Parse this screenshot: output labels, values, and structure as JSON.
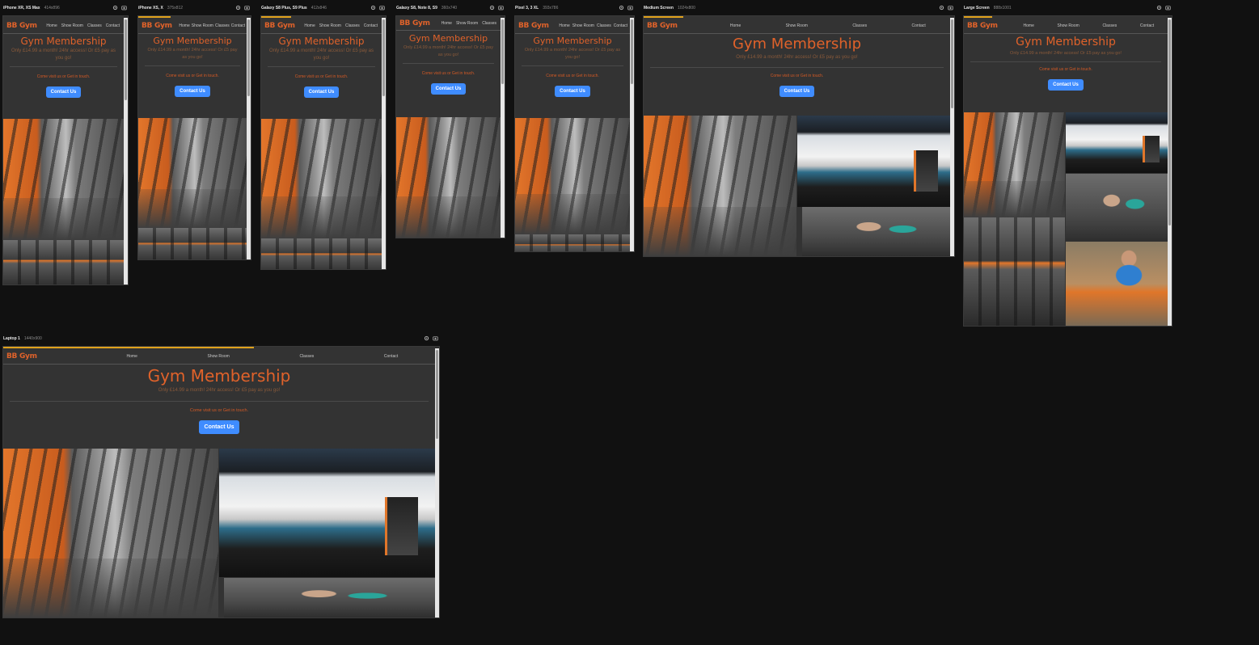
{
  "site": {
    "brand": "BB Gym",
    "nav": [
      "Home",
      "Show Room",
      "Classes",
      "Contact"
    ],
    "hero_title": "Gym Membership",
    "hero_subtitle": "Only £14.99 a month! 24hr access! Or £5 pay as you go!",
    "visit_text": "Come visit us or Get in touch.",
    "cta_label": "Contact Us"
  },
  "devices": [
    {
      "name": "iPhone XR, XS Max",
      "size": "414x896"
    },
    {
      "name": "iPhone XS, X",
      "size": "375x812"
    },
    {
      "name": "Galaxy S8 Plus, S9 Plus",
      "size": "412x846"
    },
    {
      "name": "Galaxy S8, Note 8, S9",
      "size": "360x740"
    },
    {
      "name": "Pixel 3, 3 XL",
      "size": "393x786"
    },
    {
      "name": "Medium Screen",
      "size": "1024x800"
    },
    {
      "name": "Large Screen",
      "size": "888x1001"
    },
    {
      "name": "Laptop 1",
      "size": "1440x900"
    }
  ],
  "icons": {
    "settings": "gear-icon",
    "screenshot": "camera-icon"
  },
  "colors": {
    "brand": "#e0622a",
    "accent": "#e0a21c",
    "button": "#3f8cff",
    "page_bg": "#111111",
    "site_bg": "#333333"
  }
}
